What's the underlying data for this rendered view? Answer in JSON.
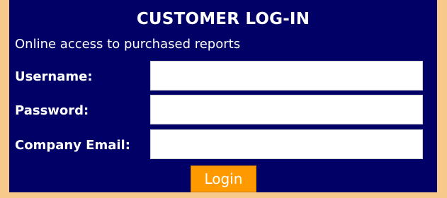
{
  "panel": {
    "title": "CUSTOMER LOG-IN",
    "subtitle": "Online access to purchased reports"
  },
  "form": {
    "username_label": "Username:",
    "username_value": "",
    "password_label": "Password:",
    "password_value": "",
    "email_label": "Company Email:",
    "email_value": "",
    "login_label": "Login"
  },
  "colors": {
    "page_background": "#f7c98a",
    "panel_background": "#000066",
    "button_background": "#ff9900"
  }
}
